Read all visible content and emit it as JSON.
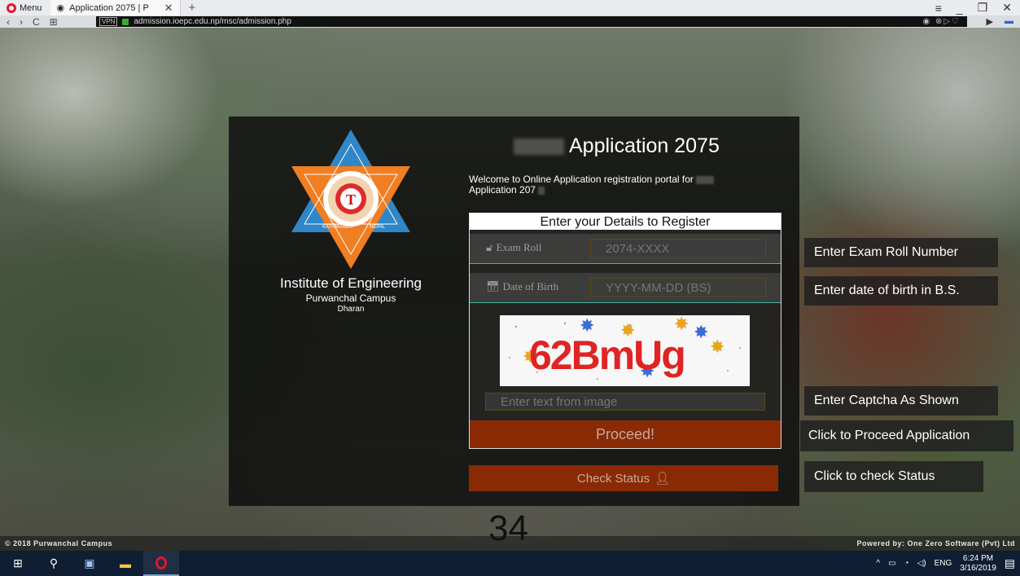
{
  "browser": {
    "menu_label": "Menu",
    "tab_title": "Application 2075 | P",
    "new_tab": "+",
    "url": "admission.ioepc.edu.np/msc/admission.php",
    "vpn_badge": "VPN"
  },
  "institute": {
    "name": "Institute of Engineering",
    "campus": "Purwanchal Campus",
    "city": "Dharan",
    "logo_words": [
      "KATHMANDU",
      "NEPAL",
      "TRIBHUVAN UNIVERSITY"
    ]
  },
  "header": {
    "title": "Application 2075",
    "welcome": "Welcome to Online Application registration portal for",
    "welcome_tail": "Application 207"
  },
  "form": {
    "heading": "Enter your Details to Register",
    "exam_roll_label": "Exam Roll",
    "exam_roll_placeholder": "2074-XXXX",
    "dob_label": "Date of Birth",
    "dob_placeholder": "YYYY-MM-DD (BS)",
    "captcha_text": "62BmUg",
    "captcha_placeholder": "Enter text from image",
    "proceed_label": "Proceed!",
    "check_status_label": "Check Status"
  },
  "hints": {
    "exam_roll": "Enter Exam Roll Number",
    "dob": "Enter date of birth in B.S.",
    "captcha": "Enter Captcha As Shown",
    "proceed": "Click to Proceed Application",
    "check": "Click to check Status"
  },
  "footer": {
    "left": "© 2018 Purwanchal Campus",
    "right": "Powered by: One Zero Software (Pvt) Ltd"
  },
  "page_number": "34",
  "taskbar": {
    "language": "ENG",
    "time": "6:24 PM",
    "date": "3/16/2019"
  },
  "colors": {
    "button_bg": "#8a2a05",
    "accent_line": "#3bb8a0",
    "logo_orange": "#f07e22",
    "logo_blue": "#2f86c8"
  }
}
